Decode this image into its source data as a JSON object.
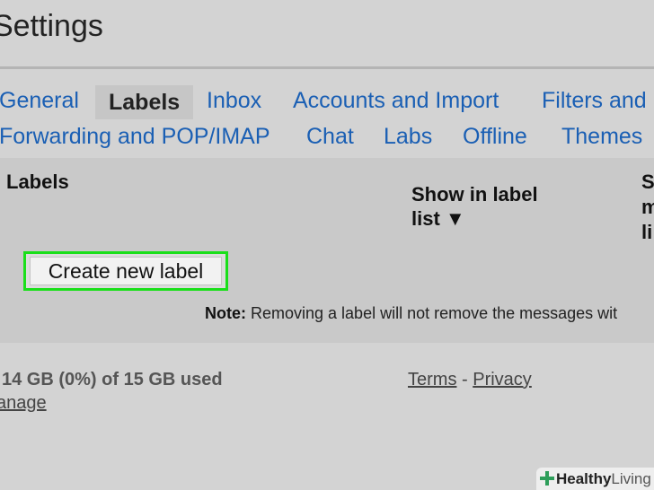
{
  "page": {
    "title": "Settings"
  },
  "tabs_row1": [
    {
      "label": "General",
      "active": false
    },
    {
      "label": "Labels",
      "active": true
    },
    {
      "label": "Inbox",
      "active": false
    },
    {
      "label": "Accounts and Import",
      "active": false
    },
    {
      "label": "Filters and",
      "active": false
    }
  ],
  "tabs_row2": [
    {
      "label": "Forwarding and POP/IMAP"
    },
    {
      "label": "Chat"
    },
    {
      "label": "Labs"
    },
    {
      "label": "Offline"
    },
    {
      "label": "Themes"
    }
  ],
  "labels_section": {
    "heading": "Labels",
    "col_show_line1": "Show in label",
    "col_show_line2": "list ▼",
    "col_cut_1": "S",
    "col_cut_2": "m",
    "col_cut_3": "li",
    "create_button": "Create new label",
    "note_bold": "Note:",
    "note_text": " Removing a label will not remove the messages wit"
  },
  "footer": {
    "storage": "14 GB (0%) of 15 GB used",
    "manage": "anage",
    "terms": "Terms",
    "separator": " - ",
    "privacy": "Privacy"
  },
  "watermark": {
    "brand_bold": "Healthy",
    "brand_light": "Living",
    "icon": "plus-cross-icon"
  },
  "colors": {
    "link": "#1a5fb4",
    "highlight": "#1adf1a",
    "background": "#d3d3d3"
  }
}
